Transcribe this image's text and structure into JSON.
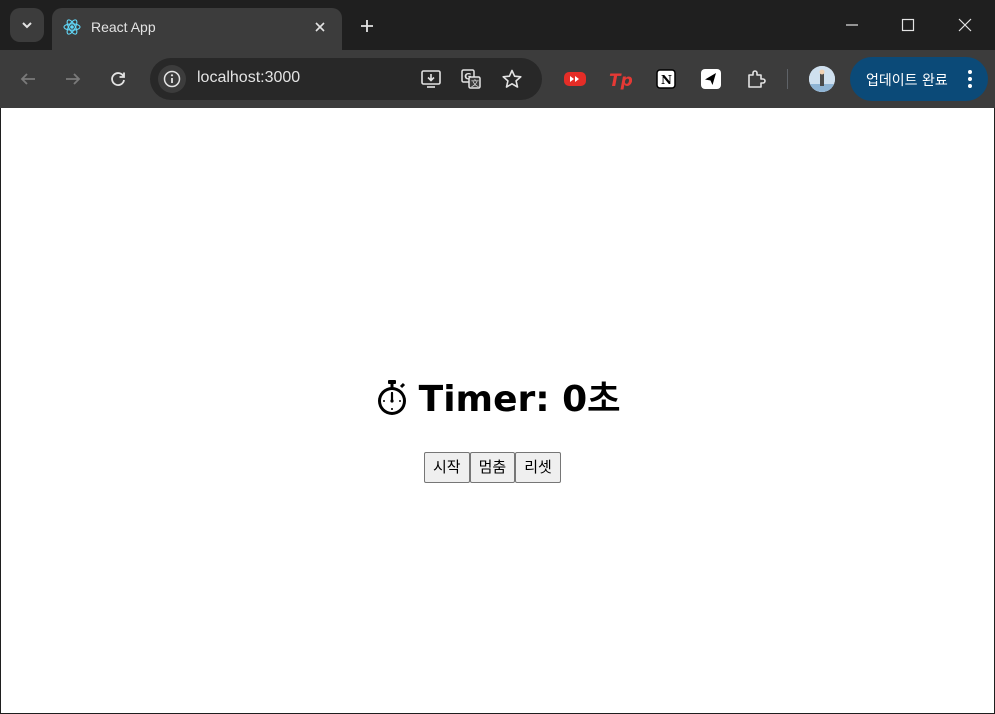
{
  "browser": {
    "tab": {
      "title": "React App",
      "favicon": "react-icon"
    },
    "url": "localhost:3000",
    "update_button_label": "업데이트 완료",
    "extensions": [
      "youtube-ext-icon",
      "tp-ext-icon",
      "notion-ext-icon",
      "send-ext-icon",
      "puzzle-icon"
    ],
    "colors": {
      "frame": "#1f1f1f",
      "toolbar": "#3c3c3c",
      "update_button": "#0b4a78"
    }
  },
  "app": {
    "timer_label": "Timer: 0초",
    "buttons": {
      "start": "시작",
      "stop": "멈춤",
      "reset": "리셋"
    }
  }
}
